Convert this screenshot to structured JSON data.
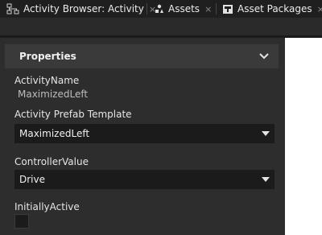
{
  "tabs": [
    {
      "label": "Activity Browser: Activity",
      "icon": "hierarchy-icon"
    },
    {
      "label": "Assets",
      "icon": "assets-icon"
    },
    {
      "label": "Asset Packages",
      "icon": "asset-packages-icon"
    }
  ],
  "tab_close_glyph": "×",
  "section": {
    "title": "Properties"
  },
  "properties": {
    "activity_name": {
      "label": "ActivityName",
      "value": "MaximizedLeft"
    },
    "prefab_template": {
      "label": "Activity Prefab Template",
      "value": "MaximizedLeft"
    },
    "controller_value": {
      "label": "ControllerValue",
      "value": "Drive"
    },
    "initially_active": {
      "label": "InitiallyActive",
      "checked": false
    }
  },
  "colors": {
    "tabbar": "#1f1f1f",
    "panel": "#2d2d2d",
    "header": "#3a3a3a",
    "field": "#1b1b1b"
  }
}
